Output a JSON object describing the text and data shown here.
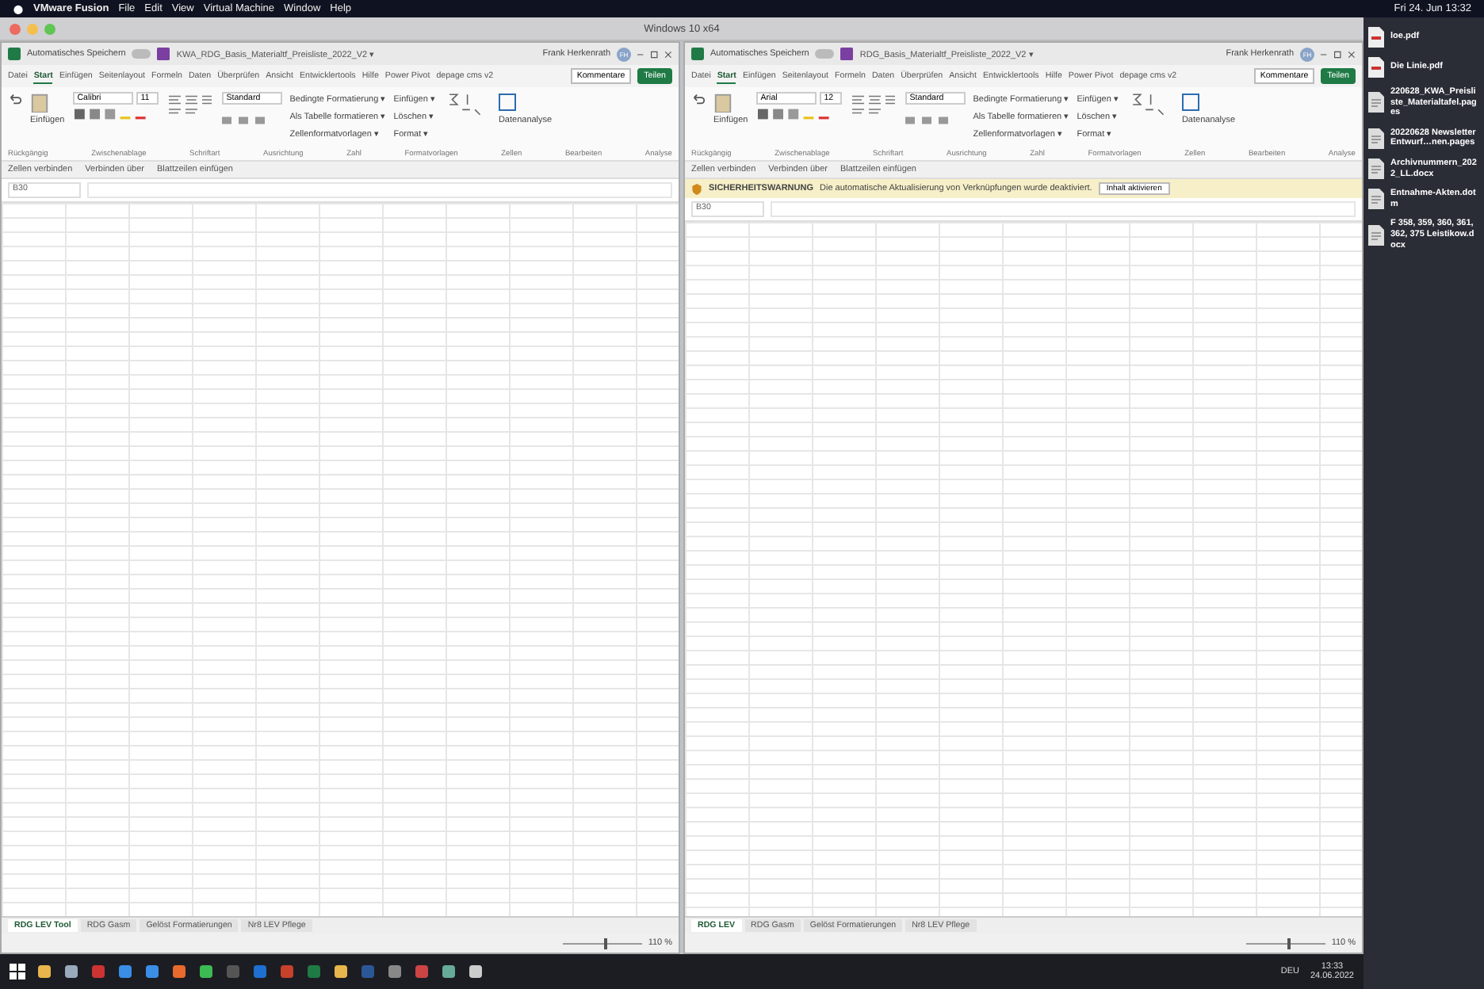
{
  "menubar": {
    "items": [
      "VMware Fusion",
      "File",
      "Edit",
      "View",
      "Virtual Machine",
      "Window",
      "Help"
    ],
    "clock": "Fri 24. Jun 13:32"
  },
  "vm_window": {
    "title": "Windows 10 x64"
  },
  "excel_windows": [
    {
      "autosave_label": "Automatisches Speichern",
      "autosave_on": false,
      "file_title": "KWA_RDG_Basis_Materialtf_Preisliste_2022_V2 ▾",
      "user": "Frank Herkenrath",
      "initials": "FH",
      "tabs": [
        {
          "label": "Datei",
          "selected": false
        },
        {
          "label": "Start",
          "selected": true
        },
        {
          "label": "Einfügen",
          "selected": false
        },
        {
          "label": "Seitenlayout",
          "selected": false
        },
        {
          "label": "Formeln",
          "selected": false
        },
        {
          "label": "Daten",
          "selected": false
        },
        {
          "label": "Überprüfen",
          "selected": false
        },
        {
          "label": "Ansicht",
          "selected": false
        },
        {
          "label": "Entwicklertools",
          "selected": false
        },
        {
          "label": "Hilfe",
          "selected": false
        },
        {
          "label": "Power Pivot",
          "selected": false
        },
        {
          "label": "depage cms v2",
          "selected": false
        }
      ],
      "comments": "Kommentare",
      "share": "Teilen",
      "font": "Calibri",
      "font_size": "11",
      "number_format": "Standard",
      "styles": [
        "Bedingte Formatierung ▾",
        "Als Tabelle formatieren ▾",
        "Zellenformatvorlagen ▾"
      ],
      "cells": [
        "Einfügen ▾",
        "Löschen ▾",
        "Format ▾"
      ],
      "paste": "Einfügen",
      "analysis": "Datenanalyse",
      "groups": [
        "Rückgängig",
        "Zwischenablage",
        "Schriftart",
        "Ausrichtung",
        "Zahl",
        "Formatvorlagen",
        "Zellen",
        "Bearbeiten",
        "Analyse"
      ],
      "merge_row": [
        "Zellen verbinden",
        "Verbinden über",
        "Blattzeilen einfügen"
      ],
      "name_box": "B30",
      "sheet_tabs": [
        {
          "label": "RDG LEV Tool",
          "selected": true
        },
        {
          "label": "RDG Gasm",
          "selected": false
        },
        {
          "label": "Gelöst Formatierungen",
          "selected": false
        },
        {
          "label": "Nr8 LEV Pflege",
          "selected": false
        }
      ],
      "zoom_slider": {
        "level": 0.55
      },
      "zoom": "110 %"
    },
    {
      "autosave_label": "Automatisches Speichern",
      "autosave_on": false,
      "file_title": "RDG_Basis_Materialtf_Preisliste_2022_V2 ▾",
      "user": "Frank Herkenrath",
      "initials": "FH",
      "tabs": [
        {
          "label": "Datei",
          "selected": false
        },
        {
          "label": "Start",
          "selected": true
        },
        {
          "label": "Einfügen",
          "selected": false
        },
        {
          "label": "Seitenlayout",
          "selected": false
        },
        {
          "label": "Formeln",
          "selected": false
        },
        {
          "label": "Daten",
          "selected": false
        },
        {
          "label": "Überprüfen",
          "selected": false
        },
        {
          "label": "Ansicht",
          "selected": false
        },
        {
          "label": "Entwicklertools",
          "selected": false
        },
        {
          "label": "Hilfe",
          "selected": false
        },
        {
          "label": "Power Pivot",
          "selected": false
        },
        {
          "label": "depage cms v2",
          "selected": false
        }
      ],
      "comments": "Kommentare",
      "share": "Teilen",
      "font": "Arial",
      "font_size": "12",
      "number_format": "Standard",
      "styles": [
        "Bedingte Formatierung ▾",
        "Als Tabelle formatieren ▾",
        "Zellenformatvorlagen ▾"
      ],
      "cells": [
        "Einfügen ▾",
        "Löschen ▾",
        "Format ▾"
      ],
      "paste": "Einfügen",
      "analysis": "Datenanalyse",
      "groups": [
        "Rückgängig",
        "Zwischenablage",
        "Schriftart",
        "Ausrichtung",
        "Zahl",
        "Formatvorlagen",
        "Zellen",
        "Bearbeiten",
        "Analyse"
      ],
      "merge_row": [
        "Zellen verbinden",
        "Verbinden über",
        "Blattzeilen einfügen"
      ],
      "warning": {
        "title": "SICHERHEITSWARNUNG",
        "text": "Die automatische Aktualisierung von Verknüpfungen wurde deaktiviert.",
        "button": "Inhalt aktivieren"
      },
      "name_box": "B30",
      "sheet_tabs": [
        {
          "label": "RDG LEV",
          "selected": true
        },
        {
          "label": "RDG Gasm",
          "selected": false
        },
        {
          "label": "Gelöst Formatierungen",
          "selected": false
        },
        {
          "label": "Nr8 LEV Pflege",
          "selected": false
        }
      ],
      "zoom_slider": {
        "level": 0.55
      },
      "zoom": "110 %"
    }
  ],
  "desktop_files": [
    {
      "name": "loe.pdf",
      "kind": "pdf"
    },
    {
      "name": "Die Linie.pdf",
      "kind": "pdf"
    },
    {
      "name": "220628_KWA_Preisliste_Materialtafel.pages",
      "kind": "doc"
    },
    {
      "name": "20220628 Newsletter Entwurf…nen.pages",
      "kind": "doc"
    },
    {
      "name": "Archivnummern_2022_LL.docx",
      "kind": "doc"
    },
    {
      "name": "Entnahme-Akten.dotm",
      "kind": "doc"
    },
    {
      "name": "F 358, 359, 360, 361, 362, 375 Leistikow.docx",
      "kind": "doc"
    }
  ],
  "taskbar": {
    "language": "DEU",
    "time": "13:33",
    "date": "24.06.2022"
  }
}
